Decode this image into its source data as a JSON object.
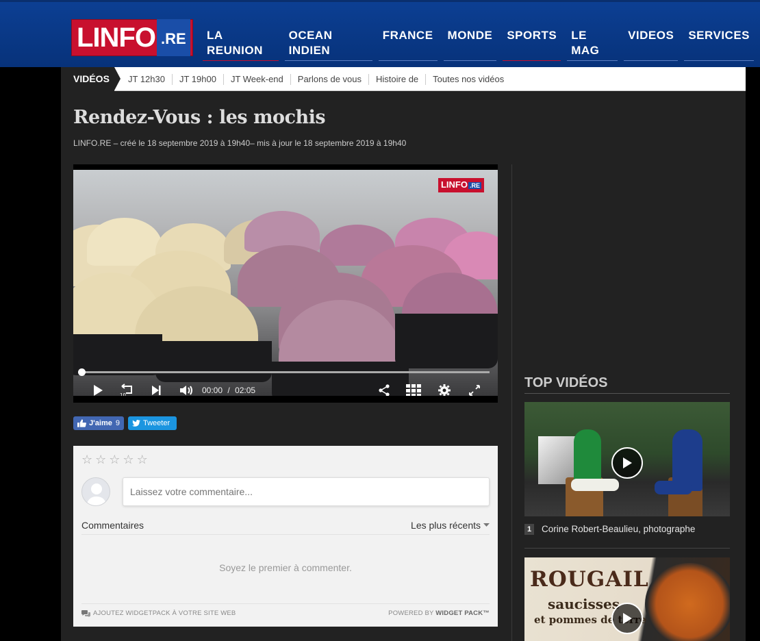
{
  "header": {
    "logo_main": "LINFO",
    "logo_suffix": ".RE",
    "nav": [
      "LA REUNION",
      "OCEAN INDIEN",
      "FRANCE",
      "MONDE",
      "SPORTS",
      "LE MAG",
      "VIDEOS",
      "SERVICES"
    ]
  },
  "subnav": {
    "label": "VIDÉOS",
    "links": [
      "JT 12h30",
      "JT 19h00",
      "JT Week-end",
      "Parlons de vous",
      "Histoire de",
      "Toutes nos vidéos"
    ]
  },
  "article": {
    "title": "Rendez-Vous : les mochis",
    "meta": "LINFO.RE – créé le 18 septembre 2019 à 19h40– mis à jour le 18 septembre 2019 à 19h40"
  },
  "player": {
    "watermark_main": "LINFO",
    "watermark_suffix": ".RE",
    "current_time": "00:00",
    "time_sep": "/",
    "duration": "02:05",
    "progress": 0
  },
  "social": {
    "like_label": "J'aime",
    "like_count": "9",
    "tweet_label": "Tweeter"
  },
  "comments": {
    "placeholder": "Laissez votre commentaire...",
    "heading": "Commentaires",
    "sort_label": "Les plus récents",
    "empty_text": "Soyez le premier à commenter.",
    "footer_left": "AJOUTEZ WIDGETPACK À VOTRE SITE WEB",
    "footer_right_prefix": "POWERED BY ",
    "footer_right_brand": "WIDGET PACK™"
  },
  "sidebar": {
    "title": "TOP VIDÉOS",
    "videos": [
      {
        "rank": "1",
        "title": "Corine Robert-Beaulieu, photographe"
      }
    ],
    "thumb2_line1": "ROUGAIL",
    "thumb2_line2": "saucisses",
    "thumb2_line3": "et pommes de terre"
  },
  "colors": {
    "header_blue": "#0c3f93",
    "logo_red": "#c8102e",
    "facebook": "#4267b2",
    "twitter": "#1b95e0"
  }
}
